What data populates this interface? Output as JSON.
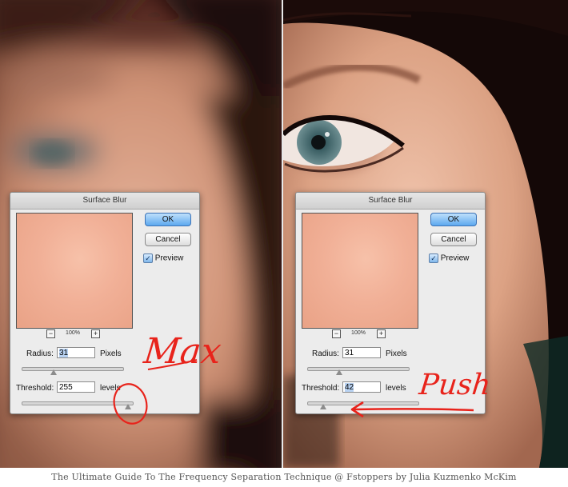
{
  "caption": "The Ultimate Guide To The Frequency Separation Technique @ Fstoppers by Julia Kuzmenko McKim",
  "left": {
    "dialog": {
      "title": "Surface Blur",
      "ok_label": "OK",
      "cancel_label": "Cancel",
      "preview_label": "Preview",
      "preview_checked": true,
      "zoom_out": "−",
      "zoom_in": "+",
      "zoom_level": "100%",
      "radius_label": "Radius:",
      "radius_value": "31",
      "radius_unit": "Pixels",
      "radius_slider_value": 31,
      "threshold_label": "Threshold:",
      "threshold_value": "255",
      "threshold_unit": "levels",
      "threshold_slider_value": 255
    },
    "annotation": "Max"
  },
  "right": {
    "dialog": {
      "title": "Surface Blur",
      "ok_label": "OK",
      "cancel_label": "Cancel",
      "preview_label": "Preview",
      "preview_checked": true,
      "zoom_out": "−",
      "zoom_in": "+",
      "zoom_level": "100%",
      "radius_label": "Radius:",
      "radius_value": "31",
      "radius_unit": "Pixels",
      "radius_slider_value": 31,
      "threshold_label": "Threshold:",
      "threshold_value": "42",
      "threshold_unit": "levels",
      "threshold_slider_value": 42
    },
    "annotation": "Push"
  },
  "colors": {
    "annotation_red": "#e8231b",
    "ok_blue": "#5ca8ef",
    "skin_tone": "#f1b097"
  }
}
